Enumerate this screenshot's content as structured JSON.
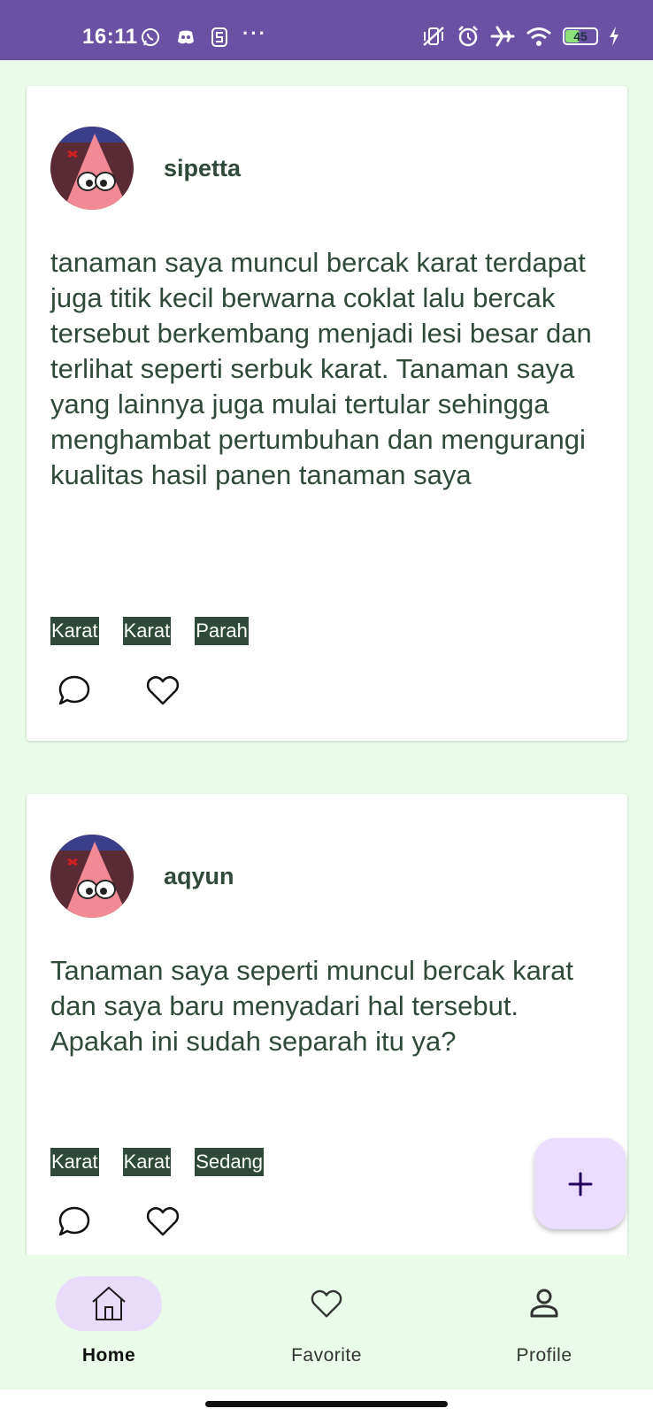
{
  "status_bar": {
    "time": "16:11",
    "battery": "45",
    "left_icons": [
      "whatsapp-icon",
      "discord-icon",
      "s-app-icon",
      "more-dots-icon"
    ],
    "right_icons": [
      "vibrate-off-icon",
      "alarm-icon",
      "airplane-icon",
      "wifi-icon",
      "battery-icon",
      "charging-icon"
    ],
    "more": "···"
  },
  "posts": [
    {
      "username": "sipetta",
      "text": "tanaman saya muncul bercak karat terdapat juga titik kecil berwarna coklat lalu bercak tersebut berkembang menjadi lesi besar dan terlihat seperti serbuk karat. Tanaman saya yang lainnya juga mulai tertular sehingga menghambat pertumbuhan dan mengurangi kualitas hasil panen tanaman saya",
      "tags": [
        "Karat",
        "Karat",
        "Parah"
      ]
    },
    {
      "username": "aqyun",
      "text": "Tanaman saya seperti muncul bercak karat dan saya baru menyadari hal tersebut. Apakah ini sudah separah itu ya?",
      "tags": [
        "Karat",
        "Karat",
        "Sedang"
      ]
    }
  ],
  "fab": {
    "icon": "plus-icon"
  },
  "bottom_nav": {
    "items": [
      {
        "label": "Home",
        "icon": "home-icon",
        "active": true
      },
      {
        "label": "Favorite",
        "icon": "heart-icon",
        "active": false
      },
      {
        "label": "Profile",
        "icon": "person-icon",
        "active": false
      }
    ]
  },
  "colors": {
    "status_bar": "#6a51a4",
    "background": "#eafbe9",
    "text": "#2f4a38",
    "tag_bg": "#2f4a38",
    "fab_bg": "#eaddff",
    "nav_active": "#e9dbfa"
  }
}
